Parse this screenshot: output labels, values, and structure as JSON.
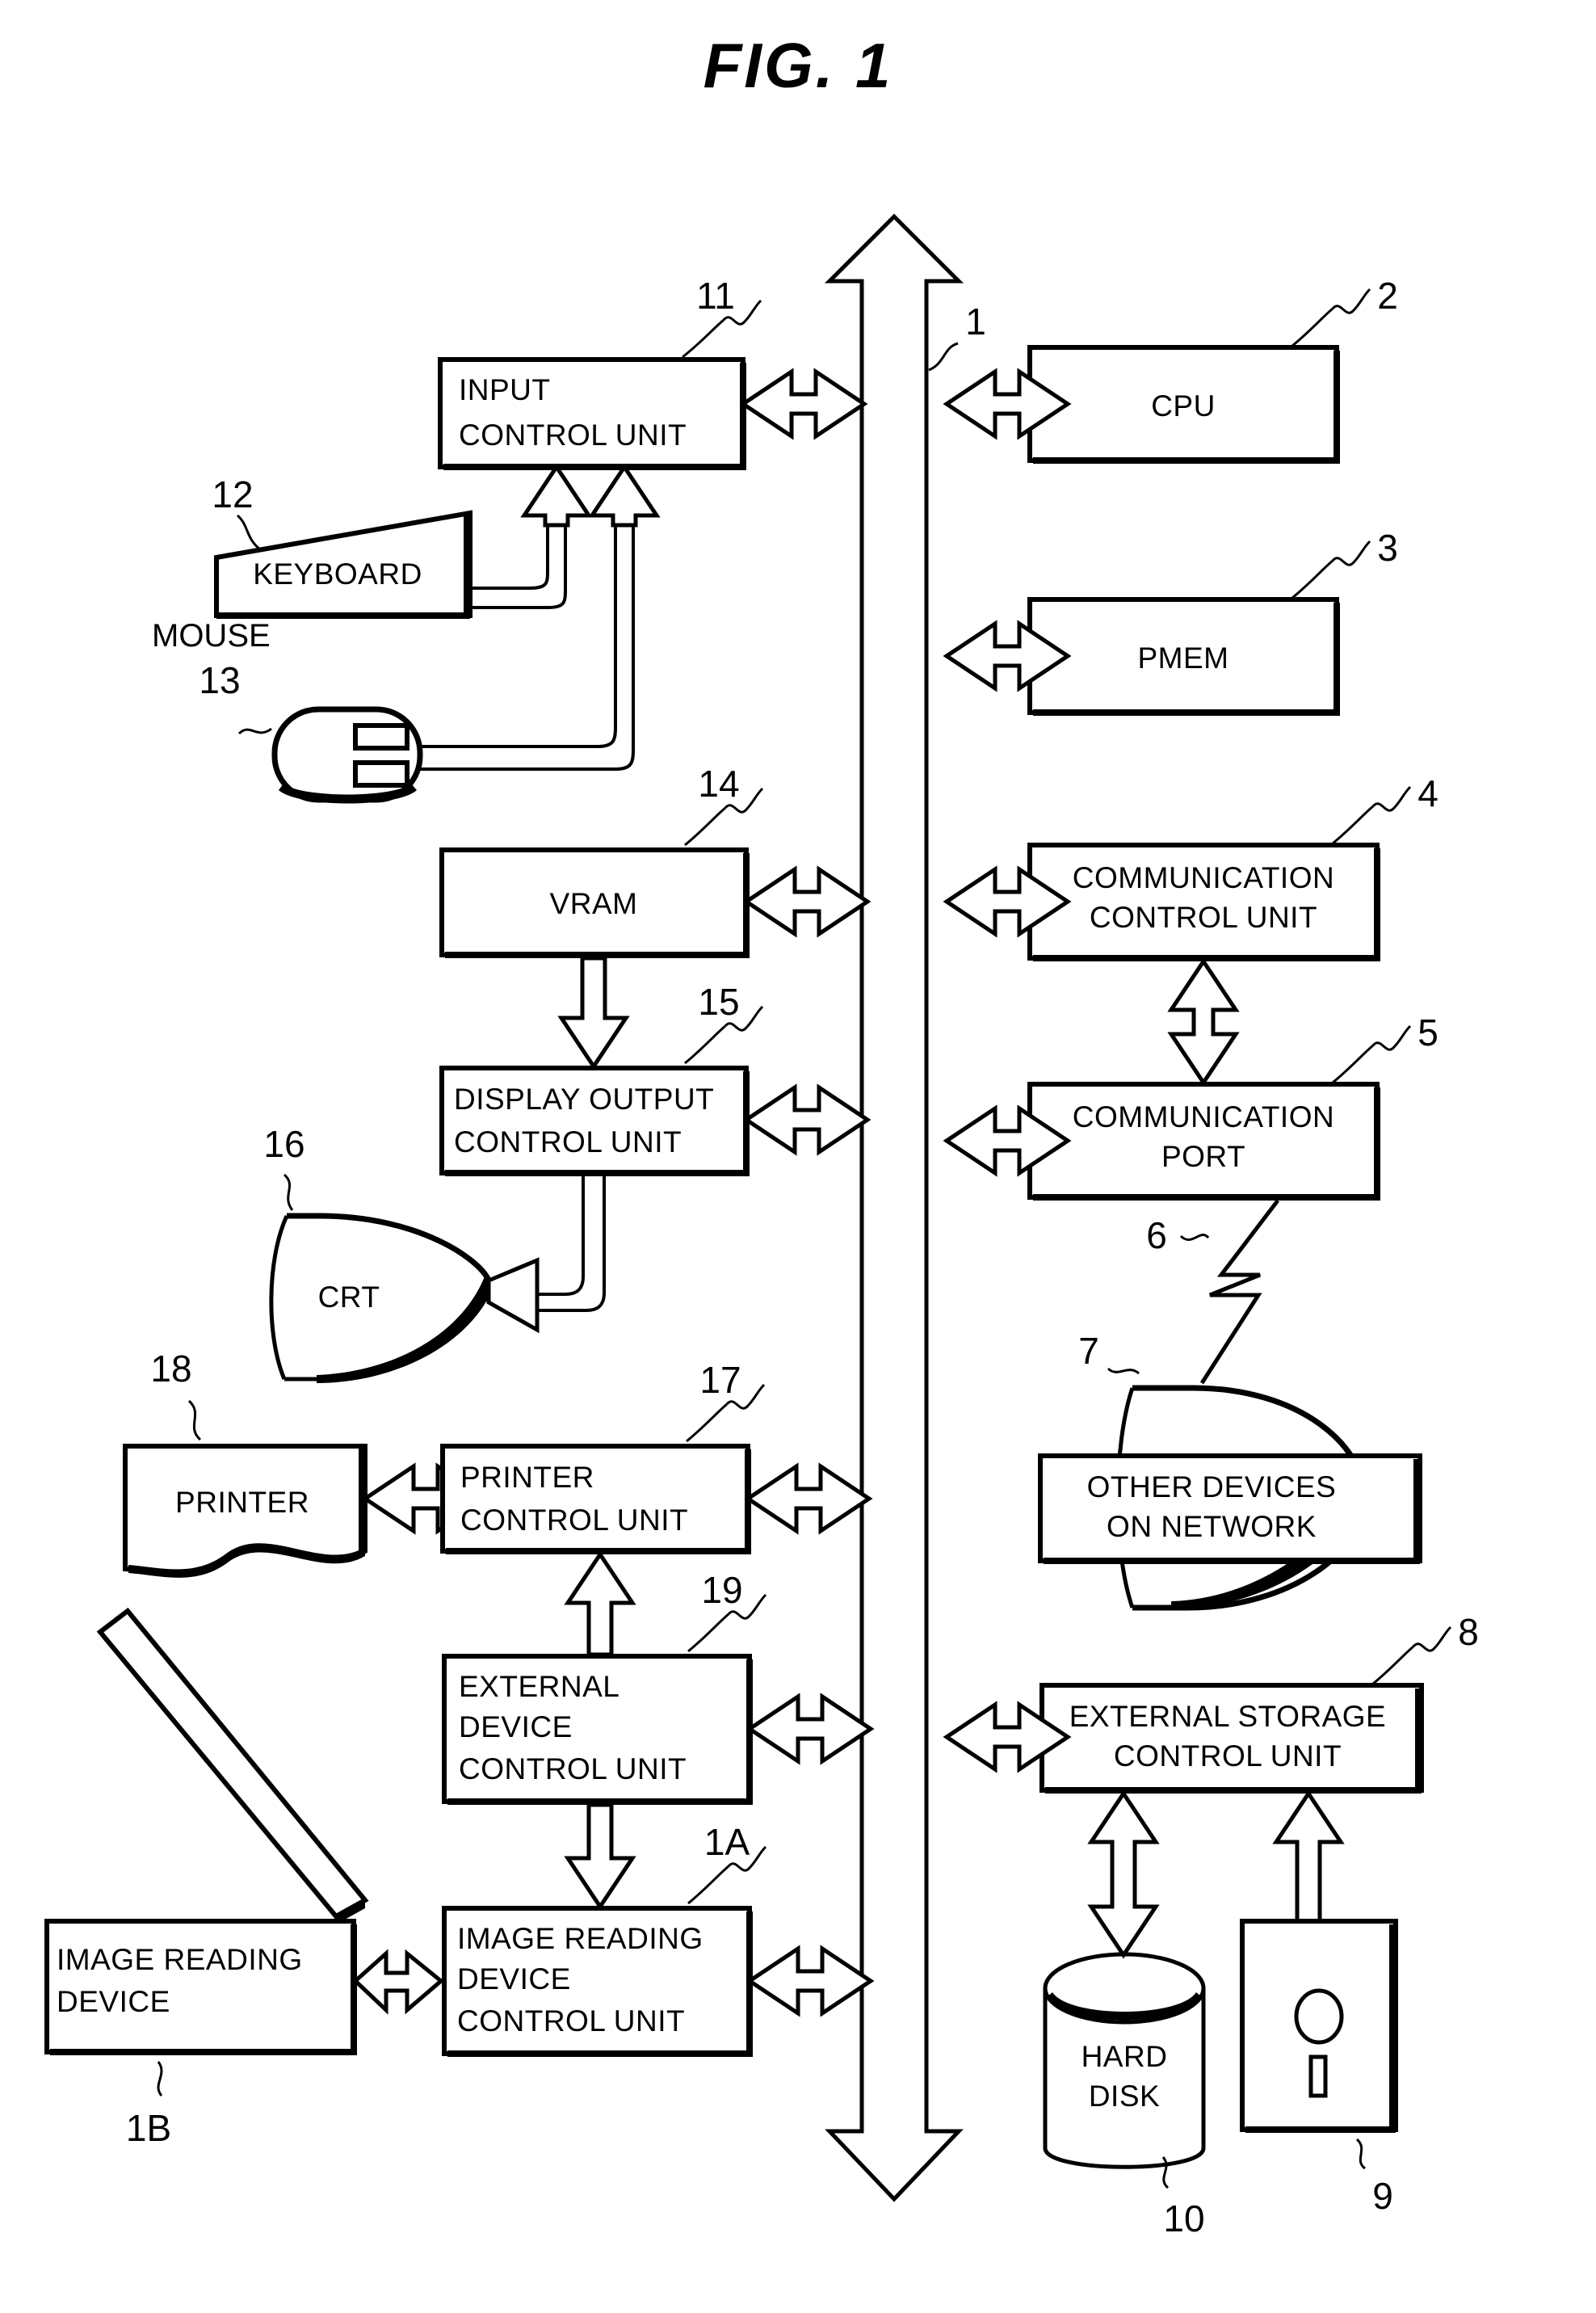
{
  "figure": {
    "title": "FIG. 1",
    "type": "patent-block-diagram",
    "background_color": "#ffffff",
    "line_color": "#000000"
  },
  "bus": {
    "ref": "1",
    "name": "system bus",
    "shape": "vertical double-headed hollow arrow"
  },
  "blocks": {
    "input_control_unit": {
      "ref": "11",
      "line1": "INPUT",
      "line2": "CONTROL UNIT"
    },
    "keyboard": {
      "ref": "12",
      "label": "KEYBOARD"
    },
    "mouse": {
      "ref": "13",
      "label": "MOUSE"
    },
    "vram": {
      "ref": "14",
      "label": "VRAM"
    },
    "display_output_control_unit": {
      "ref": "15",
      "line1": "DISPLAY OUTPUT",
      "line2": "CONTROL UNIT"
    },
    "crt": {
      "ref": "16",
      "label": "CRT"
    },
    "printer_control_unit": {
      "ref": "17",
      "line1": "PRINTER",
      "line2": "CONTROL UNIT"
    },
    "printer": {
      "ref": "18",
      "label": "PRINTER"
    },
    "external_device_control_unit": {
      "ref": "19",
      "line1": "EXTERNAL",
      "line2": "DEVICE",
      "line3": "CONTROL UNIT"
    },
    "image_reading_device_control_unit": {
      "ref": "1A",
      "line1": "IMAGE READING",
      "line2": "DEVICE",
      "line3": "CONTROL UNIT"
    },
    "image_reading_device": {
      "ref": "1B",
      "line1": "IMAGE READING",
      "line2": "DEVICE"
    },
    "cpu": {
      "ref": "2",
      "label": "CPU"
    },
    "pmem": {
      "ref": "3",
      "label": "PMEM"
    },
    "communication_control_unit": {
      "ref": "4",
      "line1": "COMMUNICATION",
      "line2": "CONTROL UNIT"
    },
    "communication_port": {
      "ref": "5",
      "line1": "COMMUNICATION",
      "line2": "PORT"
    },
    "network_cable": {
      "ref": "6",
      "label": ""
    },
    "network_cloud": {
      "ref": "7",
      "label": ""
    },
    "other_devices_on_network": {
      "line1": "OTHER DEVICES",
      "line2": "ON NETWORK"
    },
    "external_storage_control_unit": {
      "ref": "8",
      "line1": "EXTERNAL STORAGE",
      "line2": "CONTROL UNIT"
    },
    "floppy_disk": {
      "ref": "9",
      "label": ""
    },
    "hard_disk": {
      "ref": "10",
      "line1": "HARD",
      "line2": "DISK"
    }
  }
}
